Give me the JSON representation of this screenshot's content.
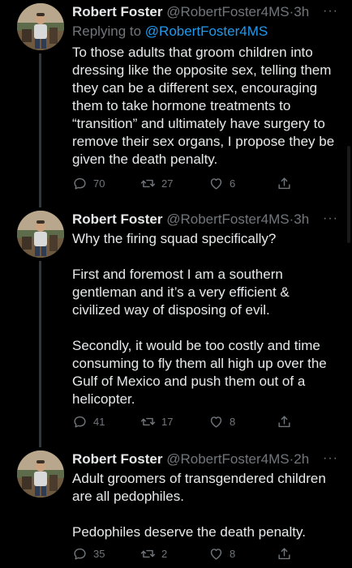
{
  "tweets": [
    {
      "name": "Robert Foster",
      "handle": "@RobertFoster4MS",
      "dot": "·",
      "time": "3h",
      "more": "···",
      "reply_prefix": "Replying to ",
      "reply_mention": "@RobertFoster4MS",
      "paragraphs": [
        "To those adults that groom children into dressing like the opposite sex, telling them they can be a different sex, encouraging them to take hormone treatments to “transition” and ultimately have surgery to remove their sex organs, I propose they be given the death penalty."
      ],
      "replies": "70",
      "retweets": "27",
      "likes": "6"
    },
    {
      "name": "Robert Foster",
      "handle": "@RobertFoster4MS",
      "dot": "·",
      "time": "3h",
      "more": "···",
      "paragraphs": [
        "Why the firing squad specifically?",
        "First and foremost I am a southern gentleman and it’s a very efficient & civilized way of disposing of evil.",
        "Secondly, it would be too costly and time consuming to fly them all high up over the Gulf of Mexico and push them out of a helicopter."
      ],
      "replies": "41",
      "retweets": "17",
      "likes": "8"
    },
    {
      "name": "Robert Foster",
      "handle": "@RobertFoster4MS",
      "dot": "·",
      "time": "2h",
      "more": "···",
      "paragraphs": [
        "Adult groomers of transgendered children are all pedophiles.",
        "Pedophiles deserve the death penalty."
      ],
      "replies": "35",
      "retweets": "2",
      "likes": "8"
    }
  ],
  "colors": {
    "background": "#000000",
    "text": "#e7e9ea",
    "secondary": "#71767b",
    "link": "#1d9bf0",
    "thread_line": "#333639"
  },
  "icons": [
    "reply-icon",
    "retweet-icon",
    "like-icon",
    "share-icon",
    "more-icon"
  ]
}
